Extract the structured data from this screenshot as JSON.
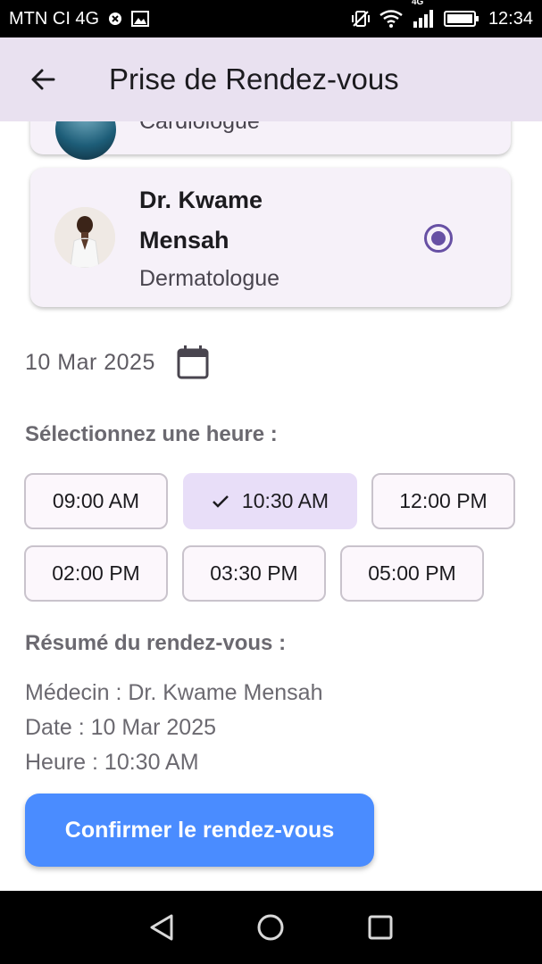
{
  "status_bar": {
    "carrier": "MTN CI 4G",
    "network_badge": "4G",
    "time": "12:34",
    "icons": [
      "blocked-icon",
      "image-icon",
      "vibrate-icon",
      "wifi-icon",
      "signal-icon",
      "battery-icon"
    ]
  },
  "app_bar": {
    "title": "Prise de Rendez-vous",
    "back_icon": "arrow-left-icon"
  },
  "doctors": [
    {
      "name": "",
      "specialty": "Cardiologue",
      "selected": false
    },
    {
      "name": "Dr. Kwame Mensah",
      "specialty": "Dermatologue",
      "selected": true
    }
  ],
  "date": {
    "value": "10 Mar 2025",
    "icon": "calendar-icon"
  },
  "time_section": {
    "label": "Sélectionnez une heure :",
    "slots": [
      {
        "label": "09:00 AM",
        "selected": false
      },
      {
        "label": "10:30 AM",
        "selected": true
      },
      {
        "label": "12:00 PM",
        "selected": false
      },
      {
        "label": "02:00 PM",
        "selected": false
      },
      {
        "label": "03:30 PM",
        "selected": false
      },
      {
        "label": "05:00 PM",
        "selected": false
      }
    ]
  },
  "summary": {
    "label": "Résumé du rendez-vous :",
    "doctor_line": "Médecin : Dr. Kwame Mensah",
    "date_line": "Date : 10 Mar 2025",
    "time_line": "Heure : 10:30 AM"
  },
  "confirm_button": "Confirmer le rendez-vous",
  "colors": {
    "primary": "#6750a4",
    "app_bar_bg": "#e9e1f0",
    "card_bg": "#f6f1f9",
    "selected_chip": "#e8def8",
    "confirm_button": "#4a8cff"
  }
}
